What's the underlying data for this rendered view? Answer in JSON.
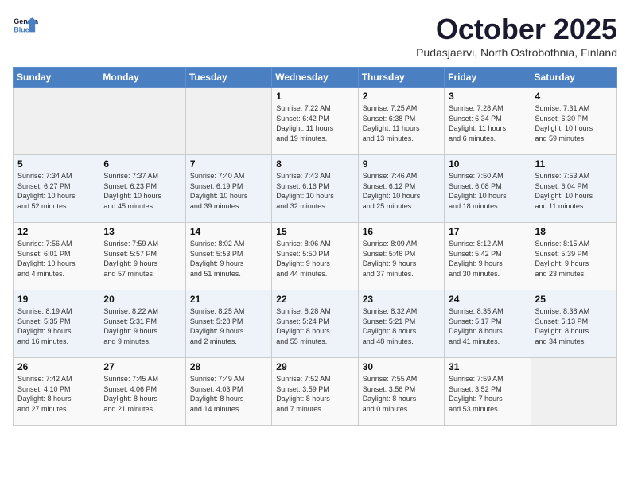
{
  "header": {
    "logo_line1": "General",
    "logo_line2": "Blue",
    "month_title": "October 2025",
    "location": "Pudasjaervi, North Ostrobothnia, Finland"
  },
  "weekdays": [
    "Sunday",
    "Monday",
    "Tuesday",
    "Wednesday",
    "Thursday",
    "Friday",
    "Saturday"
  ],
  "weeks": [
    [
      {
        "day": "",
        "info": ""
      },
      {
        "day": "",
        "info": ""
      },
      {
        "day": "",
        "info": ""
      },
      {
        "day": "1",
        "info": "Sunrise: 7:22 AM\nSunset: 6:42 PM\nDaylight: 11 hours\nand 19 minutes."
      },
      {
        "day": "2",
        "info": "Sunrise: 7:25 AM\nSunset: 6:38 PM\nDaylight: 11 hours\nand 13 minutes."
      },
      {
        "day": "3",
        "info": "Sunrise: 7:28 AM\nSunset: 6:34 PM\nDaylight: 11 hours\nand 6 minutes."
      },
      {
        "day": "4",
        "info": "Sunrise: 7:31 AM\nSunset: 6:30 PM\nDaylight: 10 hours\nand 59 minutes."
      }
    ],
    [
      {
        "day": "5",
        "info": "Sunrise: 7:34 AM\nSunset: 6:27 PM\nDaylight: 10 hours\nand 52 minutes."
      },
      {
        "day": "6",
        "info": "Sunrise: 7:37 AM\nSunset: 6:23 PM\nDaylight: 10 hours\nand 45 minutes."
      },
      {
        "day": "7",
        "info": "Sunrise: 7:40 AM\nSunset: 6:19 PM\nDaylight: 10 hours\nand 39 minutes."
      },
      {
        "day": "8",
        "info": "Sunrise: 7:43 AM\nSunset: 6:16 PM\nDaylight: 10 hours\nand 32 minutes."
      },
      {
        "day": "9",
        "info": "Sunrise: 7:46 AM\nSunset: 6:12 PM\nDaylight: 10 hours\nand 25 minutes."
      },
      {
        "day": "10",
        "info": "Sunrise: 7:50 AM\nSunset: 6:08 PM\nDaylight: 10 hours\nand 18 minutes."
      },
      {
        "day": "11",
        "info": "Sunrise: 7:53 AM\nSunset: 6:04 PM\nDaylight: 10 hours\nand 11 minutes."
      }
    ],
    [
      {
        "day": "12",
        "info": "Sunrise: 7:56 AM\nSunset: 6:01 PM\nDaylight: 10 hours\nand 4 minutes."
      },
      {
        "day": "13",
        "info": "Sunrise: 7:59 AM\nSunset: 5:57 PM\nDaylight: 9 hours\nand 57 minutes."
      },
      {
        "day": "14",
        "info": "Sunrise: 8:02 AM\nSunset: 5:53 PM\nDaylight: 9 hours\nand 51 minutes."
      },
      {
        "day": "15",
        "info": "Sunrise: 8:06 AM\nSunset: 5:50 PM\nDaylight: 9 hours\nand 44 minutes."
      },
      {
        "day": "16",
        "info": "Sunrise: 8:09 AM\nSunset: 5:46 PM\nDaylight: 9 hours\nand 37 minutes."
      },
      {
        "day": "17",
        "info": "Sunrise: 8:12 AM\nSunset: 5:42 PM\nDaylight: 9 hours\nand 30 minutes."
      },
      {
        "day": "18",
        "info": "Sunrise: 8:15 AM\nSunset: 5:39 PM\nDaylight: 9 hours\nand 23 minutes."
      }
    ],
    [
      {
        "day": "19",
        "info": "Sunrise: 8:19 AM\nSunset: 5:35 PM\nDaylight: 9 hours\nand 16 minutes."
      },
      {
        "day": "20",
        "info": "Sunrise: 8:22 AM\nSunset: 5:31 PM\nDaylight: 9 hours\nand 9 minutes."
      },
      {
        "day": "21",
        "info": "Sunrise: 8:25 AM\nSunset: 5:28 PM\nDaylight: 9 hours\nand 2 minutes."
      },
      {
        "day": "22",
        "info": "Sunrise: 8:28 AM\nSunset: 5:24 PM\nDaylight: 8 hours\nand 55 minutes."
      },
      {
        "day": "23",
        "info": "Sunrise: 8:32 AM\nSunset: 5:21 PM\nDaylight: 8 hours\nand 48 minutes."
      },
      {
        "day": "24",
        "info": "Sunrise: 8:35 AM\nSunset: 5:17 PM\nDaylight: 8 hours\nand 41 minutes."
      },
      {
        "day": "25",
        "info": "Sunrise: 8:38 AM\nSunset: 5:13 PM\nDaylight: 8 hours\nand 34 minutes."
      }
    ],
    [
      {
        "day": "26",
        "info": "Sunrise: 7:42 AM\nSunset: 4:10 PM\nDaylight: 8 hours\nand 27 minutes."
      },
      {
        "day": "27",
        "info": "Sunrise: 7:45 AM\nSunset: 4:06 PM\nDaylight: 8 hours\nand 21 minutes."
      },
      {
        "day": "28",
        "info": "Sunrise: 7:49 AM\nSunset: 4:03 PM\nDaylight: 8 hours\nand 14 minutes."
      },
      {
        "day": "29",
        "info": "Sunrise: 7:52 AM\nSunset: 3:59 PM\nDaylight: 8 hours\nand 7 minutes."
      },
      {
        "day": "30",
        "info": "Sunrise: 7:55 AM\nSunset: 3:56 PM\nDaylight: 8 hours\nand 0 minutes."
      },
      {
        "day": "31",
        "info": "Sunrise: 7:59 AM\nSunset: 3:52 PM\nDaylight: 7 hours\nand 53 minutes."
      },
      {
        "day": "",
        "info": ""
      }
    ]
  ]
}
